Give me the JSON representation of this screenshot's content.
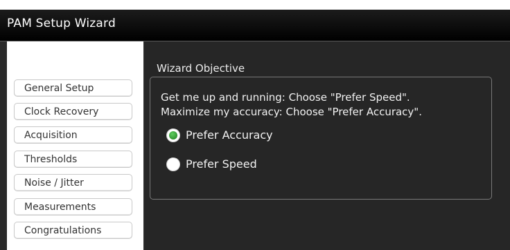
{
  "window": {
    "title": "PAM Setup Wizard"
  },
  "sidebar": {
    "items": [
      {
        "label": "General Setup"
      },
      {
        "label": "Clock Recovery"
      },
      {
        "label": "Acquisition"
      },
      {
        "label": "Thresholds"
      },
      {
        "label": "Noise / Jitter"
      },
      {
        "label": "Measurements"
      },
      {
        "label": "Congratulations"
      }
    ]
  },
  "objective": {
    "legend": "Wizard Objective",
    "line1": "Get me up and running: Choose \"Prefer Speed\".",
    "line2": "Maximize my accuracy: Choose \"Prefer Accuracy\".",
    "options": [
      {
        "label": "Prefer Accuracy",
        "selected": true
      },
      {
        "label": "Prefer Speed",
        "selected": false
      }
    ],
    "accent_color": "#2e9b2e"
  }
}
